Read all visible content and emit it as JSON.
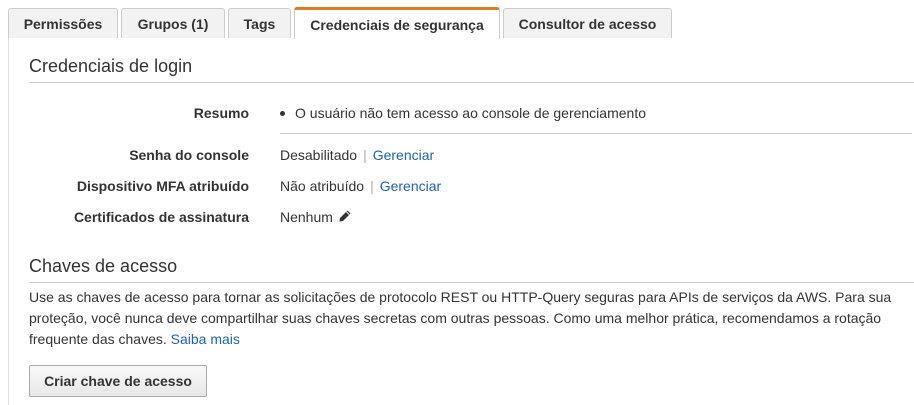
{
  "tabs": [
    {
      "label": "Permissões",
      "active": false
    },
    {
      "label": "Grupos (1)",
      "active": false
    },
    {
      "label": "Tags",
      "active": false
    },
    {
      "label": "Credenciais de segurança",
      "active": true
    },
    {
      "label": "Consultor de acesso",
      "active": false
    }
  ],
  "login": {
    "title": "Credenciais de login",
    "summary_label": "Resumo",
    "summary_item": "O usuário não tem acesso ao console de gerenciamento",
    "console_password_label": "Senha do console",
    "console_password_value": "Desabilitado",
    "console_password_link": "Gerenciar",
    "mfa_label": "Dispositivo MFA atribuído",
    "mfa_value": "Não atribuído",
    "mfa_link": "Gerenciar",
    "certs_label": "Certificados de assinatura",
    "certs_value": "Nenhum",
    "separator": "|"
  },
  "access_keys": {
    "title": "Chaves de acesso",
    "description": "Use as chaves de acesso para tornar as solicitações de protocolo REST ou HTTP-Query seguras para APIs de serviços da AWS. Para sua proteção, você nunca deve compartilhar suas chaves secretas com outras pessoas. Como uma melhor prática, recomendamos a rotação frequente das chaves.",
    "learn_more": "Saiba mais",
    "create_button": "Criar chave de acesso"
  },
  "colors": {
    "active_tab_accent": "#e07b1a",
    "link": "#1e61b0"
  }
}
